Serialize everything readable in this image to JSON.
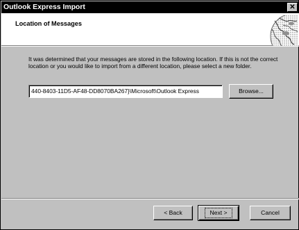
{
  "window": {
    "title": "Outlook Express Import",
    "close_label": "✕"
  },
  "header": {
    "title": "Location of Messages",
    "icon": "globe-icon"
  },
  "content": {
    "info_text": "It was determined that your messages are stored in the following location. If this is not the correct location or you would like to import from a different location, please select a new folder.",
    "path_value": "440-8403-11D5-AF48-DD8070BA267}\\Microsoft\\Outlook Express",
    "browse_label": "Browse..."
  },
  "footer": {
    "back_label": "< Back",
    "next_label": "Next >",
    "cancel_label": "Cancel"
  }
}
